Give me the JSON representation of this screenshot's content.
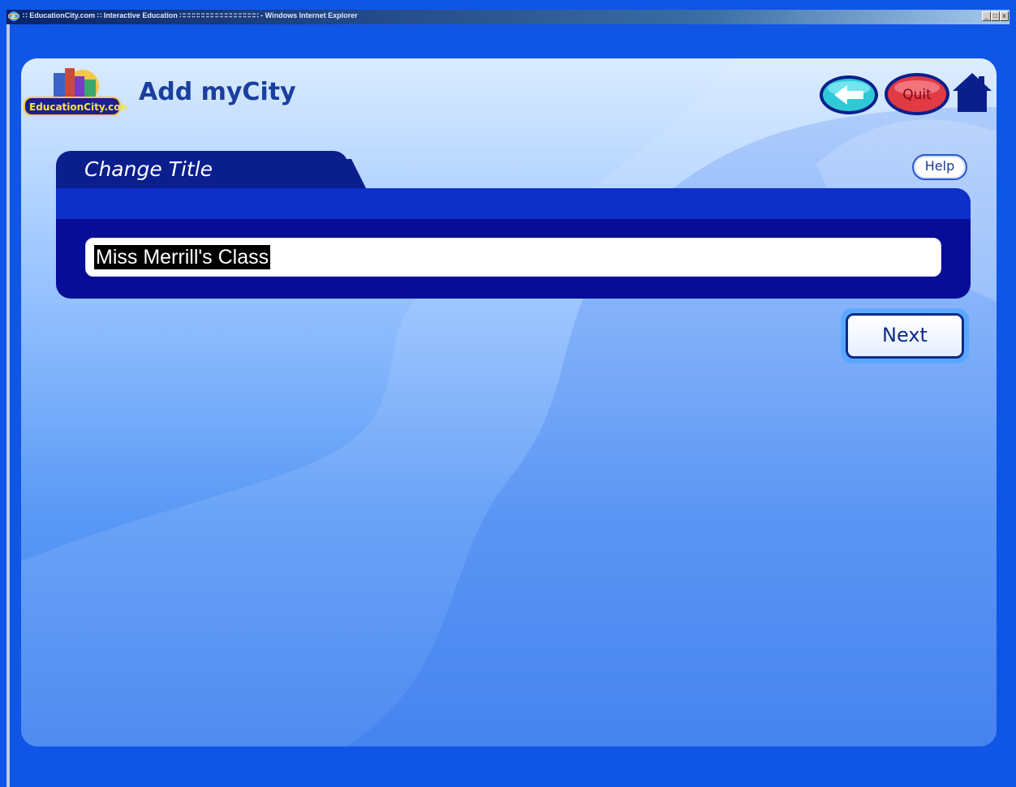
{
  "window": {
    "title": "∷ EducationCity.com ∷ Interactive Education ∷∷∷∷∷∷∷∷∷∷∷∷∷∷∷∷∷ - Windows Internet Explorer",
    "controls": [
      "_",
      "□",
      "x"
    ]
  },
  "header": {
    "logo_text": "EducationCity.com",
    "page_title": "Add myCity",
    "back_label": "",
    "quit_label": "Quit"
  },
  "card": {
    "tab_title": "Change Title",
    "help_label": "Help",
    "title_input_value": "Miss Merrill's Class",
    "next_label": "Next"
  },
  "colors": {
    "app_background": "#0f55e6",
    "card_dark": "#070d96",
    "card_tab": "#0a1e8c",
    "title_text": "#1a3f9e",
    "back_button": "#2fc8d6",
    "quit_button": "#e23a44",
    "home_icon": "#0a1e8c"
  },
  "icons": {
    "back": "arrow-left-icon",
    "home": "house-icon",
    "browser": "internet-explorer-icon"
  }
}
